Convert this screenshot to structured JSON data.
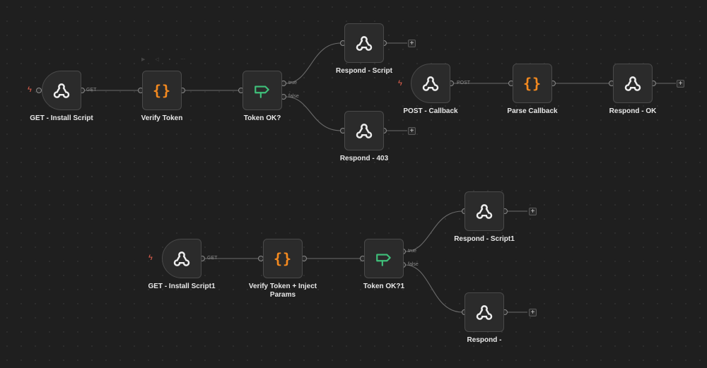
{
  "workflow": {
    "nodes": [
      {
        "id": "get_install",
        "label": "GET - Install Script",
        "icon": "webhook-icon",
        "type": "trigger",
        "port_out": "GET"
      },
      {
        "id": "verify",
        "label": "Verify Token",
        "icon": "code-braces-icon",
        "type": "code"
      },
      {
        "id": "tokenok",
        "label": "Token OK?",
        "icon": "if-signpost-icon",
        "type": "if",
        "port_true": "true",
        "port_false": "false"
      },
      {
        "id": "resp_script",
        "label": "Respond - Script",
        "icon": "webhook-icon",
        "type": "respond"
      },
      {
        "id": "resp_403",
        "label": "Respond - 403",
        "icon": "webhook-icon",
        "type": "respond"
      },
      {
        "id": "post_cb",
        "label": "POST - Callback",
        "icon": "webhook-icon",
        "type": "trigger",
        "port_out": "POST"
      },
      {
        "id": "parse_cb",
        "label": "Parse Callback",
        "icon": "code-braces-icon",
        "type": "code"
      },
      {
        "id": "resp_ok",
        "label": "Respond - OK",
        "icon": "webhook-icon",
        "type": "respond"
      },
      {
        "id": "get_install1",
        "label": "GET - Install Script1",
        "icon": "webhook-icon",
        "type": "trigger",
        "port_out": "GET"
      },
      {
        "id": "verify_inject",
        "label": "Verify Token + Inject Params",
        "icon": "code-braces-icon",
        "type": "code"
      },
      {
        "id": "tokenok1",
        "label": "Token OK?1",
        "icon": "if-signpost-icon",
        "type": "if",
        "port_true": "true",
        "port_false": "false"
      },
      {
        "id": "resp_script1",
        "label": "Respond - Script1",
        "icon": "webhook-icon",
        "type": "respond"
      },
      {
        "id": "resp_dash",
        "label": "Respond -",
        "icon": "webhook-icon",
        "type": "respond"
      }
    ],
    "add_button_label": "+",
    "trigger_icon": "lightning-bolt-icon",
    "colors": {
      "canvas": "#1f1f1f",
      "node_bg": "#2b2b2b",
      "node_border": "#4a4a4a",
      "code_accent": "#f58a1f",
      "if_accent": "#3fc07a",
      "trigger_bolt": "#e9624f",
      "edge": "#6b6b6b"
    }
  }
}
